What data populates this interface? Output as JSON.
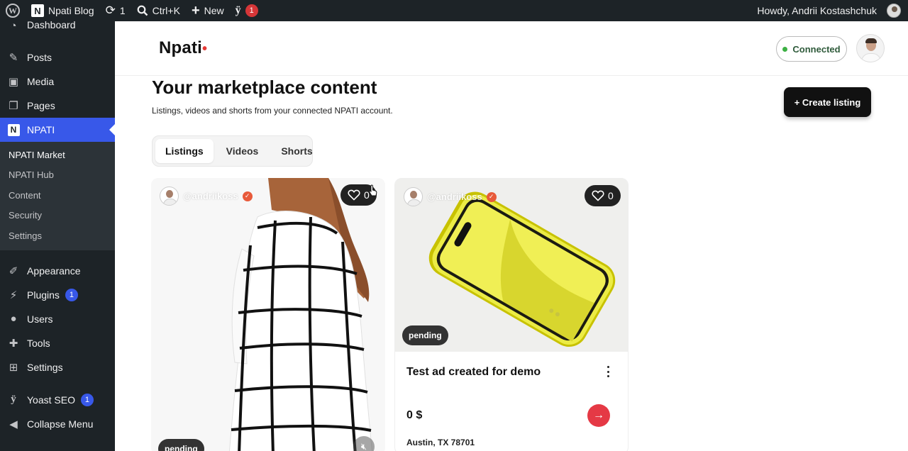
{
  "admin_bar": {
    "site_name": "Npati Blog",
    "updates_count": "1",
    "search_shortcut": "Ctrl+K",
    "new_label": "New",
    "yoast_count": "1",
    "howdy": "Howdy, Andrii Kostashchuk"
  },
  "sidebar": {
    "items": [
      {
        "label": "Dashboard",
        "icon": "dashboard-icon"
      },
      {
        "label": "Posts",
        "icon": "pin-icon"
      },
      {
        "label": "Media",
        "icon": "media-icon"
      },
      {
        "label": "Pages",
        "icon": "pages-icon"
      },
      {
        "label": "NPATI",
        "icon": "npati-icon"
      }
    ],
    "submenu": [
      "NPATI Market",
      "NPATI Hub",
      "Content",
      "Security",
      "Settings"
    ],
    "lower_items": [
      {
        "label": "Appearance",
        "icon": "brush-icon"
      },
      {
        "label": "Plugins",
        "icon": "plugin-icon",
        "badge": "1"
      },
      {
        "label": "Users",
        "icon": "user-icon"
      },
      {
        "label": "Tools",
        "icon": "wrench-icon"
      },
      {
        "label": "Settings",
        "icon": "settings-icon"
      },
      {
        "label": "Yoast SEO",
        "icon": "yoast-icon",
        "badge": "1"
      },
      {
        "label": "Collapse Menu",
        "icon": "collapse-icon"
      }
    ]
  },
  "header": {
    "brand": "Npati",
    "brand_dot": "•",
    "connection_status": "Connected"
  },
  "page": {
    "title": "Your marketplace content",
    "subtitle": "Listings, videos and shorts from your connected NPATI account.",
    "create_button": "+ Create listing"
  },
  "tabs": [
    {
      "label": "Listings",
      "active": true
    },
    {
      "label": "Videos",
      "active": false
    },
    {
      "label": "Shorts",
      "active": false
    }
  ],
  "cards": [
    {
      "username": "@andriikoss",
      "likes": "0",
      "status": "pending",
      "image": "woman-in-checked-outfit"
    },
    {
      "username": "@andriikoss",
      "likes": "0",
      "status": "pending",
      "image": "yellow-smartphone",
      "title": "Test ad created for demo",
      "price": "0 $",
      "location": "Austin, TX 78701"
    }
  ],
  "colors": {
    "admin_bg": "#1d2327",
    "accent_blue": "#3858e9",
    "brand_red": "#e53945",
    "connected_green": "#3cb043"
  }
}
